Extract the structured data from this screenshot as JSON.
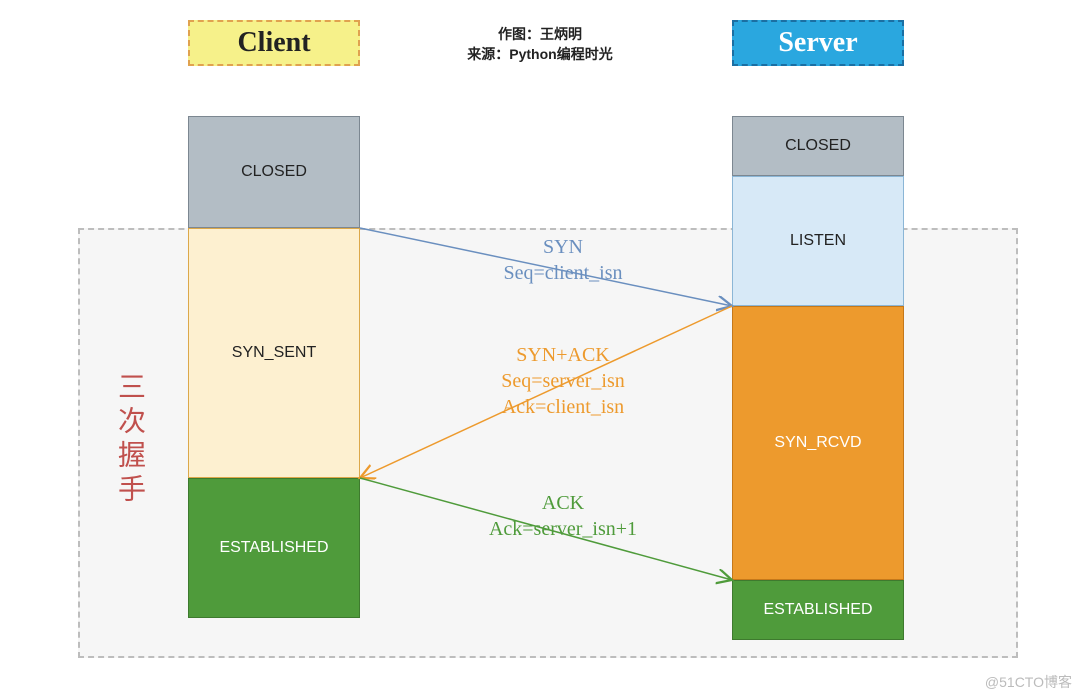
{
  "header": {
    "client": "Client",
    "server": "Server"
  },
  "credit": {
    "line1": "作图：王炳明",
    "line2": "来源：Python编程时光"
  },
  "section_label": "三次握手",
  "client_states": {
    "closed": "CLOSED",
    "syn_sent": "SYN_SENT",
    "established": "ESTABLISHED"
  },
  "server_states": {
    "closed": "CLOSED",
    "listen": "LISTEN",
    "syn_rcvd": "SYN_RCVD",
    "established": "ESTABLISHED"
  },
  "messages": {
    "syn": {
      "title": "SYN",
      "seq": "Seq=client_isn"
    },
    "synack": {
      "title": "SYN+ACK",
      "seq": "Seq=server_isn",
      "ack": "Ack=client_isn"
    },
    "ack": {
      "title": "ACK",
      "ack": "Ack=server_isn+1"
    }
  },
  "colors": {
    "client_hdr_bg": "#f6f18a",
    "client_hdr_border": "#e0a24f",
    "server_hdr_bg": "#2aa7df",
    "server_hdr_border": "#1b6fa3",
    "closed_bg": "#b3bdc5",
    "closed_border": "#7c8791",
    "syn_sent_bg": "#fdf0d0",
    "syn_sent_border": "#dca84a",
    "listen_bg": "#d7e9f7",
    "listen_border": "#8bb6d6",
    "syn_rcvd_bg": "#ed9a2d",
    "syn_rcvd_border": "#c5781a",
    "established_bg": "#4f9b3b",
    "established_border": "#3e7a2e",
    "section_bg": "#f6f6f6",
    "section_border": "#bdbdbd",
    "msg1": "#6a8fbf",
    "msg2": "#ed9a2d",
    "msg3": "#4f9b3b"
  },
  "watermark": "@51CTO博客"
}
